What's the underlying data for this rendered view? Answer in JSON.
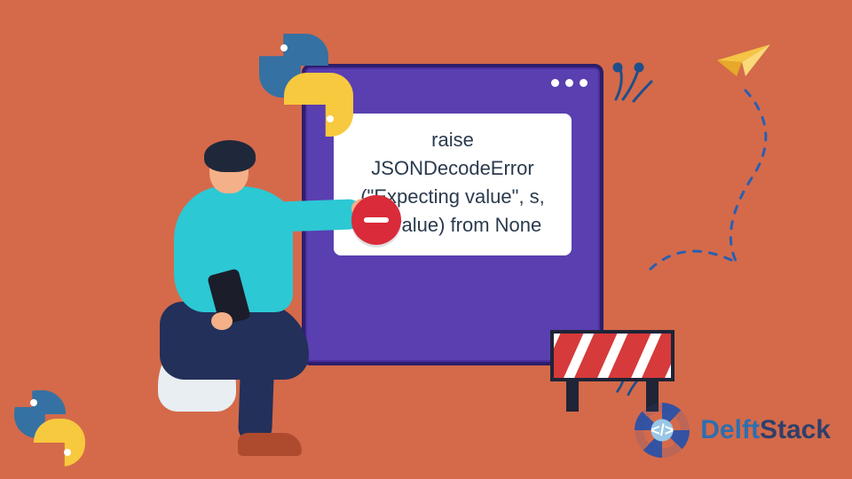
{
  "window": {
    "title_dots": 3,
    "message": "raise JSONDecodeError (\"Expecting value\", s, err.value) from None"
  },
  "icons": {
    "python_top": "python-logo",
    "python_bottom": "python-logo",
    "stop_sign": "no-entry",
    "paper_plane": "paper-plane",
    "barrier": "construction-barrier"
  },
  "brand": {
    "glyph": "</>",
    "name_part1": "Delft",
    "name_part2": "Stack"
  },
  "colors": {
    "bg": "#d46a4a",
    "window": "#5a3fb0",
    "window_border": "#2d1e6b",
    "accent_teal": "#2cc8d4",
    "stop": "#d92b3a",
    "brand_blue": "#2d6fb0",
    "brand_dark": "#2f3f6a"
  }
}
